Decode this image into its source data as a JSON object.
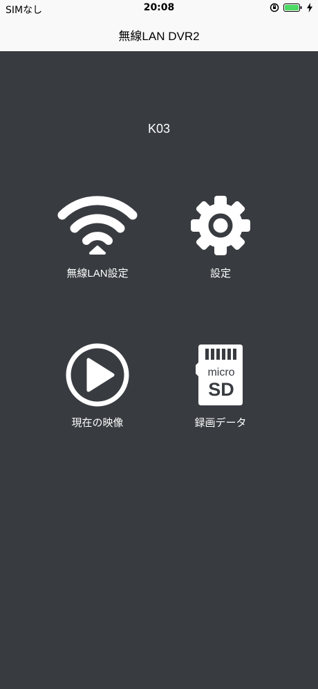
{
  "status_bar": {
    "carrier": "SIMなし",
    "time": "20:08"
  },
  "nav": {
    "title": "無線LAN DVR2"
  },
  "device": {
    "name": "K03"
  },
  "menu": [
    {
      "label": "無線LAN設定",
      "icon": "wifi-icon"
    },
    {
      "label": "設定",
      "icon": "gear-icon"
    },
    {
      "label": "現在の映像",
      "icon": "play-icon"
    },
    {
      "label": "録画データ",
      "icon": "microsd-icon",
      "icon_text": [
        "micro",
        "SD"
      ]
    }
  ]
}
